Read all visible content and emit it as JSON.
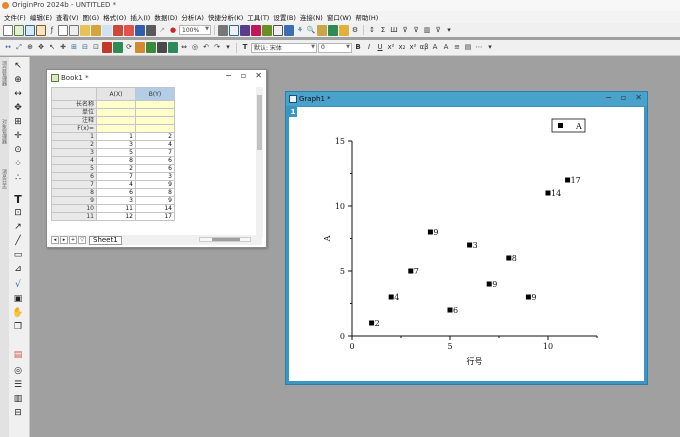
{
  "window": {
    "title": "OriginPro 2024b - UNTITLED *"
  },
  "menu": [
    "文件(F)",
    "编辑(E)",
    "查看(V)",
    "图(G)",
    "格式(O)",
    "插入(I)",
    "数据(D)",
    "分析(A)",
    "快捷分析(K)",
    "工具(T)",
    "设置(B)",
    "连接(N)",
    "窗口(W)",
    "帮助(H)"
  ],
  "toolbar2": {
    "zoom": "100%",
    "font_name": "默认: 宋体",
    "font_size": "0"
  },
  "sidetabs": [
    "项目管理器",
    "对象管理器",
    "消息日志"
  ],
  "book": {
    "title": "Book1 *",
    "columns": [
      "A(X)",
      "B(Y)"
    ],
    "meta_rows": [
      "长名称",
      "单位",
      "注释",
      "F(x)="
    ],
    "rows": [
      [
        "1",
        "1",
        "2"
      ],
      [
        "2",
        "3",
        "4"
      ],
      [
        "3",
        "5",
        "7"
      ],
      [
        "4",
        "8",
        "6"
      ],
      [
        "5",
        "2",
        "6"
      ],
      [
        "6",
        "7",
        "3"
      ],
      [
        "7",
        "4",
        "9"
      ],
      [
        "8",
        "6",
        "8"
      ],
      [
        "9",
        "3",
        "9"
      ],
      [
        "10",
        "11",
        "14"
      ],
      [
        "11",
        "12",
        "17"
      ]
    ],
    "sheet_tab": "Sheet1"
  },
  "graph": {
    "title": "Graph1 *",
    "layer": "1"
  },
  "chart_data": {
    "type": "scatter",
    "series": [
      {
        "name": "A",
        "points": [
          [
            1,
            1,
            "2"
          ],
          [
            2,
            3,
            "4"
          ],
          [
            3,
            5,
            "7"
          ],
          [
            4,
            8,
            "9"
          ],
          [
            5,
            2,
            "6"
          ],
          [
            6,
            7,
            "3"
          ],
          [
            7,
            4,
            "9"
          ],
          [
            8,
            6,
            "8"
          ],
          [
            9,
            3,
            "9"
          ],
          [
            10,
            11,
            "14"
          ],
          [
            11,
            12,
            "17"
          ]
        ]
      }
    ],
    "xlabel": "行号",
    "ylabel": "A",
    "xlim": [
      0,
      12.5
    ],
    "ylim": [
      0,
      15
    ],
    "xticks": [
      0,
      5,
      10
    ],
    "yticks": [
      0,
      5,
      10,
      15
    ],
    "legend": "top-right",
    "grid": false,
    "marker_color": "#000000"
  }
}
